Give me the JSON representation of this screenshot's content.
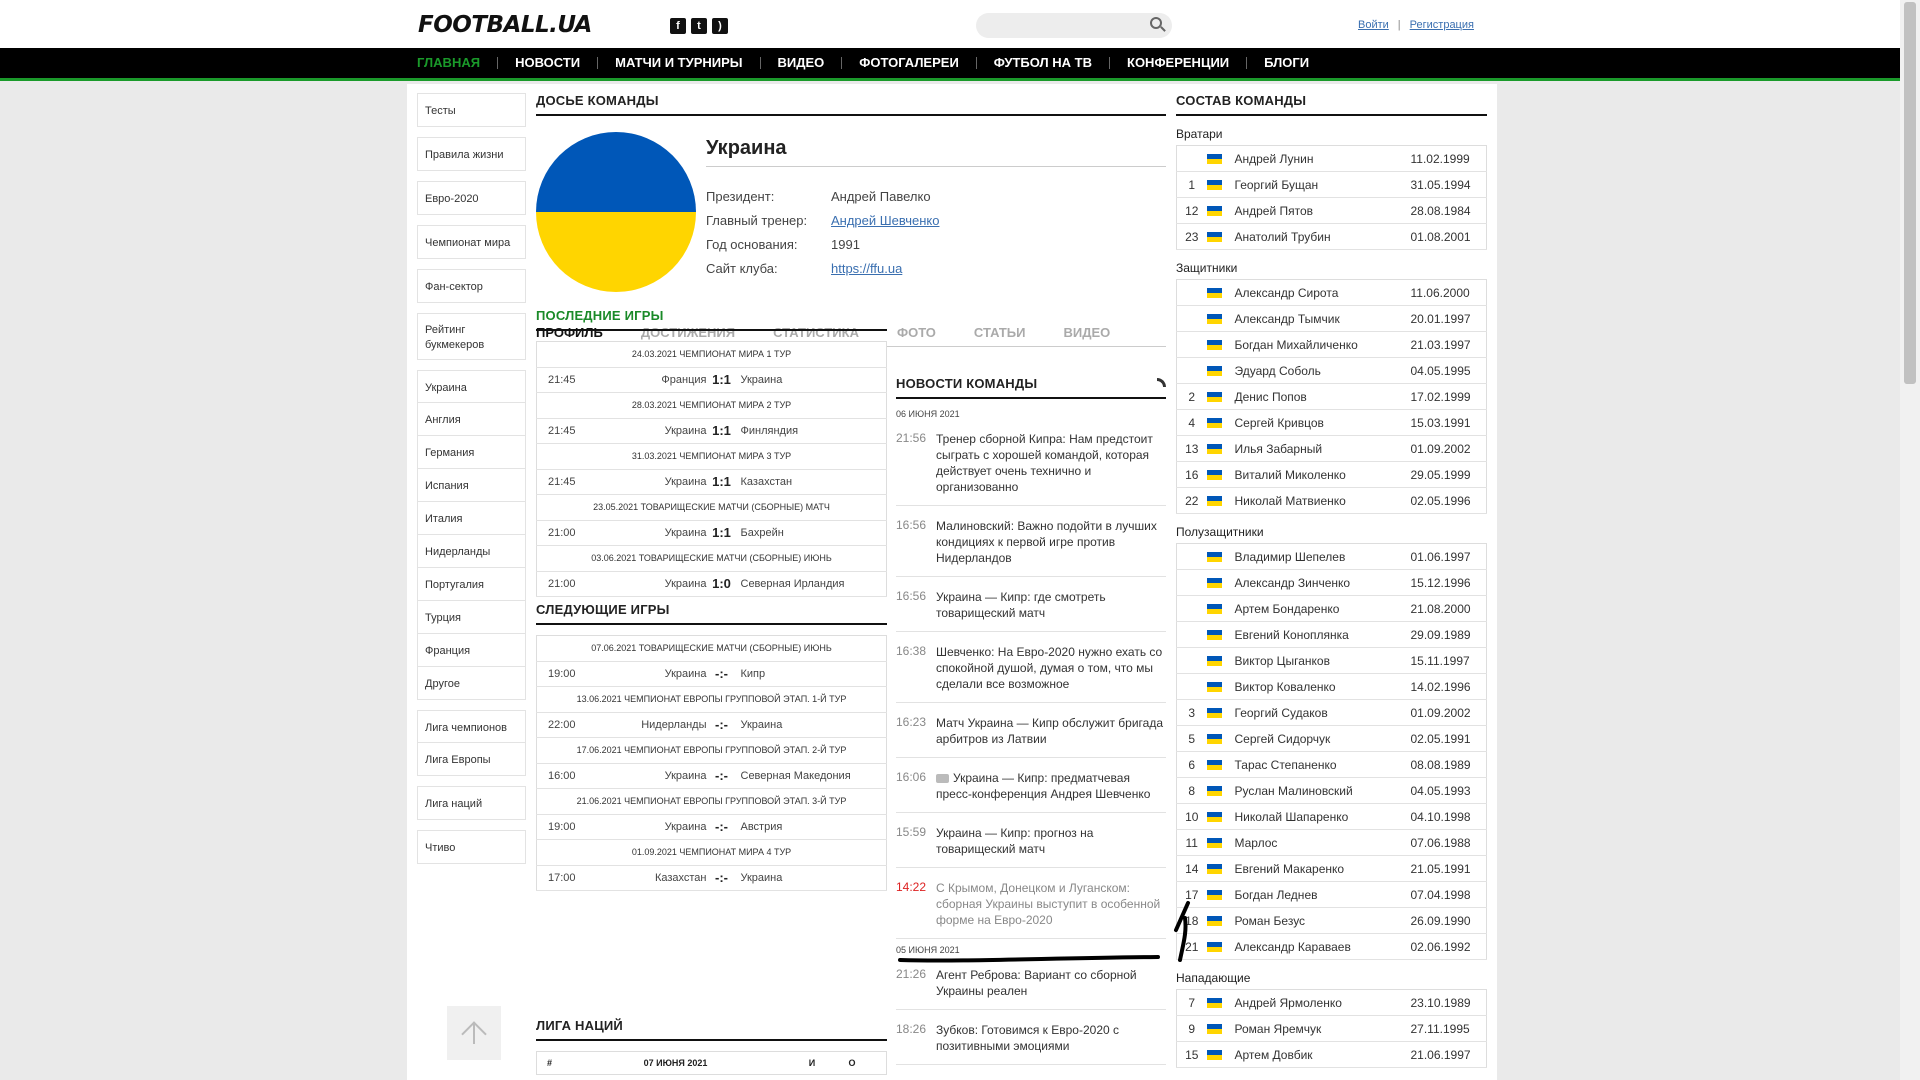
{
  "header": {
    "logo": "FOOTBALL.UA",
    "social": [
      "f",
      "t",
      "rss"
    ],
    "login": "Войти",
    "register": "Регистрация",
    "search_placeholder": ""
  },
  "nav": [
    "ГЛАВНАЯ",
    "НОВОСТИ",
    "МАТЧИ И ТУРНИРЫ",
    "ВИДЕО",
    "ФОТОГАЛЕРЕИ",
    "ФУТБОЛ НА ТВ",
    "КОНФЕРЕНЦИИ",
    "БЛОГИ"
  ],
  "leftnav": {
    "top": [
      "Тесты",
      "Правила жизни",
      "Евро-2020",
      "Чемпионат мира",
      "Фан-сектор",
      "Рейтинг букмекеров"
    ],
    "countries": [
      "Украина",
      "Англия",
      "Германия",
      "Испания",
      "Италия",
      "Нидерланды",
      "Португалия",
      "Турция",
      "Франция",
      "Другое"
    ],
    "cups": [
      "Лига чемпионов",
      "Лига Европы"
    ],
    "bottom": [
      "Лига наций",
      "Чтиво"
    ]
  },
  "dossier": {
    "title": "ДОСЬЕ КОМАНДЫ",
    "team": "Украина",
    "president_label": "Президент:",
    "president": "Андрей Павелко",
    "coach_label": "Главный тренер:",
    "coach": "Андрей Шевченко",
    "founded_label": "Год основания:",
    "founded": "1991",
    "site_label": "Сайт клуба:",
    "site": "https://ffu.ua",
    "tabs": [
      "ПРОФИЛЬ",
      "ДОСТИЖЕНИЯ",
      "СТАТИСТИКА",
      "ФОТО",
      "СТАТЬИ",
      "ВИДЕО"
    ]
  },
  "last_games": {
    "title": "ПОСЛЕДНИЕ ИГРЫ",
    "rows": [
      {
        "head": "24.03.2021 ЧЕМПИОНАТ МИРА 1 ТУР",
        "time": "21:45",
        "home": "Франция",
        "score": "1:1",
        "away": "Украина"
      },
      {
        "head": "28.03.2021 ЧЕМПИОНАТ МИРА 2 ТУР",
        "time": "21:45",
        "home": "Украина",
        "score": "1:1",
        "away": "Финляндия"
      },
      {
        "head": "31.03.2021 ЧЕМПИОНАТ МИРА 3 ТУР",
        "time": "21:45",
        "home": "Украина",
        "score": "1:1",
        "away": "Казахстан"
      },
      {
        "head": "23.05.2021 ТОВАРИЩЕСКИЕ МАТЧИ (СБОРНЫЕ) МАТЧ",
        "time": "21:00",
        "home": "Украина",
        "score": "1:1",
        "away": "Бахрейн"
      },
      {
        "head": "03.06.2021 ТОВАРИЩЕСКИЕ МАТЧИ (СБОРНЫЕ) ИЮНЬ",
        "time": "21:00",
        "home": "Украина",
        "score": "1:0",
        "away": "Северная Ирландия"
      }
    ]
  },
  "next_games": {
    "title": "СЛЕДУЮЩИЕ ИГРЫ",
    "rows": [
      {
        "head": "07.06.2021 ТОВАРИЩЕСКИЕ МАТЧИ (СБОРНЫЕ) ИЮНЬ",
        "time": "19:00",
        "home": "Украина",
        "score": "-:-",
        "away": "Кипр"
      },
      {
        "head": "13.06.2021 ЧЕМПИОНАТ ЕВРОПЫ ГРУППОВОЙ ЭТАП. 1-Й ТУР",
        "time": "22:00",
        "home": "Нидерланды",
        "score": "-:-",
        "away": "Украина"
      },
      {
        "head": "17.06.2021 ЧЕМПИОНАТ ЕВРОПЫ ГРУППОВОЙ ЭТАП. 2-Й ТУР",
        "time": "16:00",
        "home": "Украина",
        "score": "-:-",
        "away": "Северная Македония"
      },
      {
        "head": "21.06.2021 ЧЕМПИОНАТ ЕВРОПЫ ГРУППОВОЙ ЭТАП. 3-Й ТУР",
        "time": "19:00",
        "home": "Украина",
        "score": "-:-",
        "away": "Австрия"
      },
      {
        "head": "01.09.2021 ЧЕМПИОНАТ МИРА 4 ТУР",
        "time": "17:00",
        "home": "Казахстан",
        "score": "-:-",
        "away": "Украина"
      }
    ]
  },
  "liga": {
    "title": "ЛИГА НАЦИЙ",
    "hdr": [
      "#",
      "07 ИЮНЯ 2021",
      "И",
      "О"
    ]
  },
  "news": {
    "title": "НОВОСТИ КОМАНДЫ",
    "date1": "06 ИЮНЯ 2021",
    "items1": [
      {
        "time": "21:56",
        "text": "Тренер сборной Кипра: Нам предстоит сыграть с хорошей командой, которая действует очень технично и организованно"
      },
      {
        "time": "16:56",
        "text": "Малиновский: Важно подойти в лучших кондициях к первой игре против Нидерландов"
      },
      {
        "time": "16:56",
        "text": "Украина — Кипр: где смотреть товарищеский матч"
      },
      {
        "time": "16:38",
        "text": "Шевченко: На Евро-2020 нужно ехать со спокойной душой, думая о том, что мы сделали все возможное"
      },
      {
        "time": "16:23",
        "text": "Матч Украина — Кипр обслужит бригада арбитров из Латвии"
      },
      {
        "time": "16:06",
        "text": "Украина — Кипр: предматчевая пресс-конференция Андрея Шевченко",
        "cam": true
      },
      {
        "time": "15:59",
        "text": "Украина — Кипр: прогноз на товарищеский матч"
      },
      {
        "time": "14:22",
        "text": "С Крымом, Донецком и Луганском: сборная Украины выступит в особенной форме на Евро-2020",
        "red": true
      }
    ],
    "date2": "05 ИЮНЯ 2021",
    "items2": [
      {
        "time": "21:26",
        "text": "Агент Реброва: Вариант со сборной Украины реален"
      },
      {
        "time": "18:26",
        "text": "Зубков: Готовимся к Евро-2020 с позитивными эмоциями"
      }
    ]
  },
  "roster": {
    "title": "СОСТАВ КОМАНДЫ",
    "groups": [
      {
        "name": "Вратари",
        "players": [
          {
            "num": "",
            "name": "Андрей Лунин",
            "dob": "11.02.1999"
          },
          {
            "num": "1",
            "name": "Георгий Бущан",
            "dob": "31.05.1994"
          },
          {
            "num": "12",
            "name": "Андрей Пятов",
            "dob": "28.08.1984"
          },
          {
            "num": "23",
            "name": "Анатолий Трубин",
            "dob": "01.08.2001"
          }
        ]
      },
      {
        "name": "Защитники",
        "players": [
          {
            "num": "",
            "name": "Александр Сирота",
            "dob": "11.06.2000"
          },
          {
            "num": "",
            "name": "Александр Тымчик",
            "dob": "20.01.1997"
          },
          {
            "num": "",
            "name": "Богдан Михайличенко",
            "dob": "21.03.1997"
          },
          {
            "num": "",
            "name": "Эдуард Соболь",
            "dob": "04.05.1995"
          },
          {
            "num": "2",
            "name": "Денис Попов",
            "dob": "17.02.1999"
          },
          {
            "num": "4",
            "name": "Сергей Кривцов",
            "dob": "15.03.1991"
          },
          {
            "num": "13",
            "name": "Илья Забарный",
            "dob": "01.09.2002"
          },
          {
            "num": "16",
            "name": "Виталий Миколенко",
            "dob": "29.05.1999"
          },
          {
            "num": "22",
            "name": "Николай Матвиенко",
            "dob": "02.05.1996"
          }
        ]
      },
      {
        "name": "Полузащитники",
        "players": [
          {
            "num": "",
            "name": "Владимир Шепелев",
            "dob": "01.06.1997"
          },
          {
            "num": "",
            "name": "Александр Зинченко",
            "dob": "15.12.1996"
          },
          {
            "num": "",
            "name": "Артем Бондаренко",
            "dob": "21.08.2000"
          },
          {
            "num": "",
            "name": "Евгений Коноплянка",
            "dob": "29.09.1989"
          },
          {
            "num": "",
            "name": "Виктор Цыганков",
            "dob": "15.11.1997"
          },
          {
            "num": "",
            "name": "Виктор Коваленко",
            "dob": "14.02.1996"
          },
          {
            "num": "3",
            "name": "Георгий Судаков",
            "dob": "01.09.2002"
          },
          {
            "num": "5",
            "name": "Сергей Сидорчук",
            "dob": "02.05.1991"
          },
          {
            "num": "6",
            "name": "Тарас Степаненко",
            "dob": "08.08.1989"
          },
          {
            "num": "8",
            "name": "Руслан Малиновский",
            "dob": "04.05.1993"
          },
          {
            "num": "10",
            "name": "Николай Шапаренко",
            "dob": "04.10.1998"
          },
          {
            "num": "11",
            "name": "Марлос",
            "dob": "07.06.1988"
          },
          {
            "num": "14",
            "name": "Евгений Макаренко",
            "dob": "21.05.1991"
          },
          {
            "num": "17",
            "name": "Богдан Леднев",
            "dob": "07.04.1998"
          },
          {
            "num": "18",
            "name": "Роман Безус",
            "dob": "26.09.1990"
          },
          {
            "num": "21",
            "name": "Александр Караваев",
            "dob": "02.06.1992"
          }
        ]
      },
      {
        "name": "Нападающие",
        "players": [
          {
            "num": "7",
            "name": "Андрей Ярмоленко",
            "dob": "23.10.1989"
          },
          {
            "num": "9",
            "name": "Роман Яремчук",
            "dob": "27.11.1995"
          },
          {
            "num": "15",
            "name": "Артем Довбик",
            "dob": "21.06.1997"
          }
        ]
      }
    ]
  },
  "colors": {
    "accent": "#1a9a2a",
    "flag_blue": "#0057b8",
    "flag_yellow": "#ffd500"
  }
}
